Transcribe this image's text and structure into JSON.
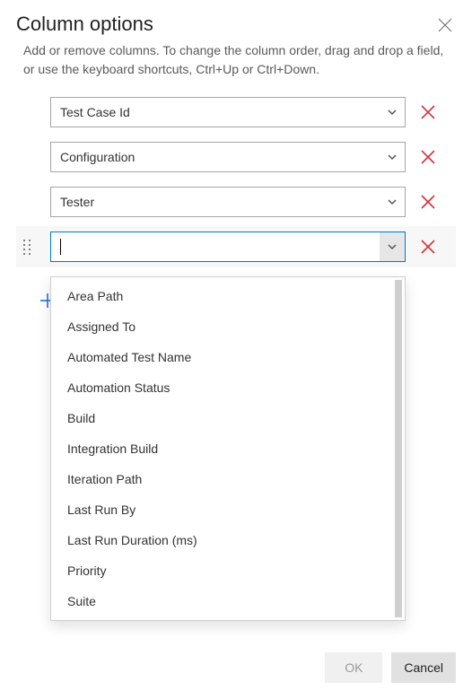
{
  "title": "Column options",
  "description": "Add or remove columns. To change the column order, drag and drop a field, or use the keyboard shortcuts, Ctrl+Up or Ctrl+Down.",
  "columns": [
    {
      "value": "Test Case Id"
    },
    {
      "value": "Configuration"
    },
    {
      "value": "Tester"
    },
    {
      "value": ""
    }
  ],
  "dropdown": {
    "options": [
      "Area Path",
      "Assigned To",
      "Automated Test Name",
      "Automation Status",
      "Build",
      "Integration Build",
      "Iteration Path",
      "Last Run By",
      "Last Run Duration (ms)",
      "Priority",
      "Suite"
    ]
  },
  "buttons": {
    "ok": "OK",
    "cancel": "Cancel"
  }
}
